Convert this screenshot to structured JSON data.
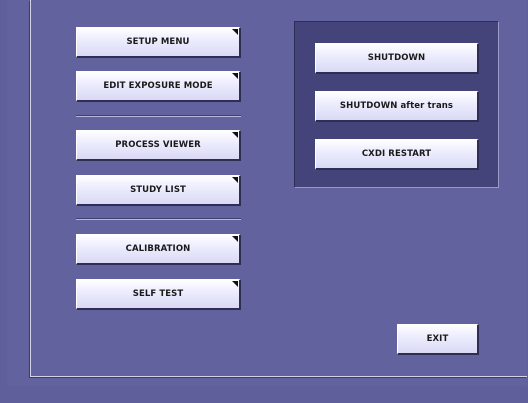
{
  "left_menu": {
    "setup_menu": "SETUP MENU",
    "edit_exposure_mode": "EDIT EXPOSURE MODE",
    "process_viewer": "PROCESS VIEWER",
    "study_list": "STUDY LIST",
    "calibration": "CALIBRATION",
    "self_test": "SELF TEST"
  },
  "system_panel": {
    "shutdown": "SHUTDOWN",
    "shutdown_after_trans": "SHUTDOWN after trans",
    "cxdi_restart": "CXDI RESTART"
  },
  "exit_label": "EXIT",
  "colors": {
    "background": "#62629f",
    "panel": "#44447a",
    "button_face": "#efefff",
    "button_shadow": "#2e2e55"
  },
  "icons": {
    "submenu_indicator": "corner-triangle-icon"
  }
}
